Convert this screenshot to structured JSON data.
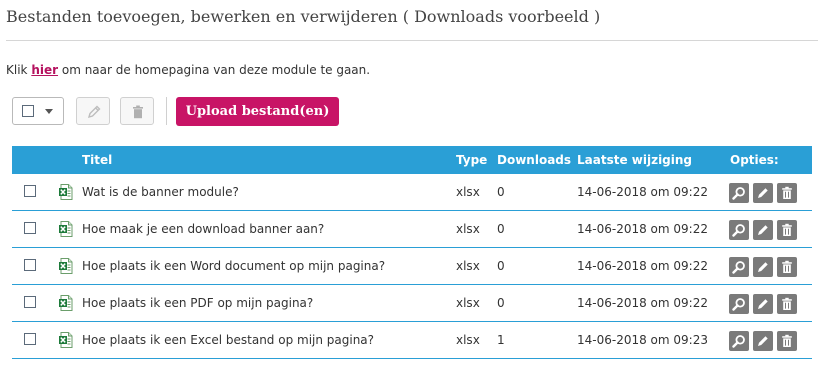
{
  "header": {
    "title": "Bestanden toevoegen, bewerken en verwijderen ( Downloads voorbeeld )"
  },
  "intro": {
    "prefix": "Klik ",
    "link": "hier",
    "suffix": " om naar de homepagina van deze module te gaan."
  },
  "toolbar": {
    "upload_label": "Upload bestand(en)"
  },
  "table": {
    "columns": {
      "title": "Titel",
      "type": "Type",
      "downloads": "Downloads",
      "modified": "Laatste wijziging",
      "options": "Opties:"
    },
    "rows": [
      {
        "title": "Wat is de banner module?",
        "type": "xlsx",
        "downloads": "0",
        "modified": "14-06-2018 om 09:22"
      },
      {
        "title": "Hoe maak je een download banner aan?",
        "type": "xlsx",
        "downloads": "0",
        "modified": "14-06-2018 om 09:22"
      },
      {
        "title": "Hoe plaats ik een Word document op mijn pagina?",
        "type": "xlsx",
        "downloads": "0",
        "modified": "14-06-2018 om 09:22"
      },
      {
        "title": "Hoe plaats ik een PDF op mijn pagina?",
        "type": "xlsx",
        "downloads": "0",
        "modified": "14-06-2018 om 09:22"
      },
      {
        "title": "Hoe plaats ik een Excel bestand op mijn pagina?",
        "type": "xlsx",
        "downloads": "1",
        "modified": "14-06-2018 om 09:23"
      }
    ]
  },
  "icons": {
    "file": "excel-file-icon",
    "view": "magnifier-icon",
    "edit": "pencil-icon",
    "delete": "trash-icon"
  },
  "colors": {
    "accent": "#c81466",
    "header": "#2a9fd6",
    "link": "#b5125f",
    "option_button": "#7a7a7a"
  }
}
